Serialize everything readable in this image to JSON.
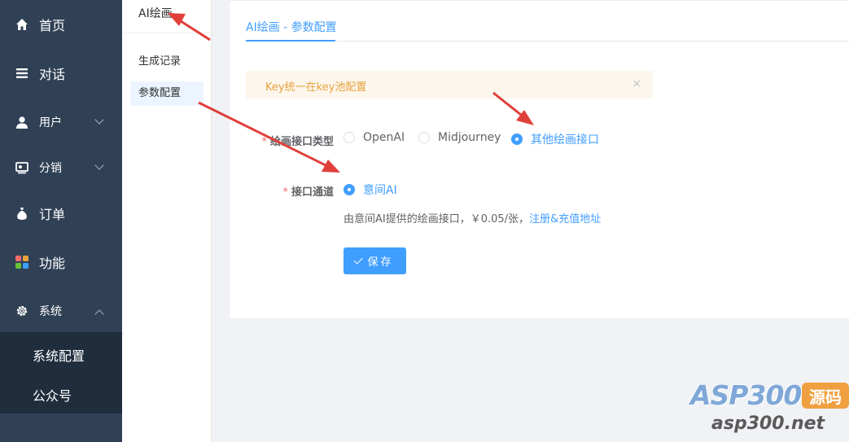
{
  "nav": {
    "items": [
      {
        "label": "首页",
        "icon": "home-icon"
      },
      {
        "label": "对话",
        "icon": "list-icon"
      },
      {
        "label": "用户",
        "icon": "user-icon"
      },
      {
        "label": "分销",
        "icon": "distribution-icon"
      },
      {
        "label": "订单",
        "icon": "money-bag-icon"
      },
      {
        "label": "功能",
        "icon": "grid-icon"
      },
      {
        "label": "系统",
        "icon": "gear-icon"
      }
    ],
    "sub_items": [
      {
        "label": "系统配置"
      },
      {
        "label": "公众号"
      }
    ]
  },
  "menu2": {
    "title": "AI绘画",
    "items": [
      {
        "label": "生成记录"
      },
      {
        "label": "参数配置"
      }
    ]
  },
  "tab": {
    "label": "AI绘画 - 参数配置"
  },
  "alert": {
    "text": "Key统一在key池配置",
    "close": "×"
  },
  "form": {
    "type_label": "绘画接口类型",
    "type_options": [
      "OpenAI",
      "Midjourney",
      "其他绘画接口"
    ],
    "type_selected": "其他绘画接口",
    "channel_label": "接口通道",
    "channel_options": [
      "意间AI"
    ],
    "channel_selected": "意间AI",
    "hint_text": "由意间AI提供的绘画接口，￥0.05/张，",
    "hint_link": "注册&充值地址",
    "save_label": "保存"
  },
  "watermark": {
    "brand": "ASP300",
    "badge": "源码",
    "url": "asp300.net"
  },
  "colors": {
    "nav_bg": "#304156",
    "nav_sub_bg": "#1f2d3d",
    "primary": "#409eff",
    "warning": "#e6a23c",
    "arrow": "#e0403a"
  }
}
